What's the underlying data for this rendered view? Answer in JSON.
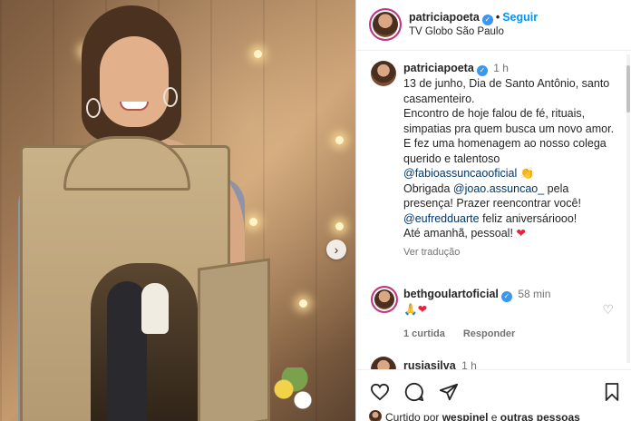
{
  "photo": {
    "next_label": "›"
  },
  "header": {
    "username": "patriciapoeta",
    "separator": "•",
    "follow_label": "Seguir",
    "location": "TV Globo São Paulo"
  },
  "caption": {
    "username": "patriciapoeta",
    "time": "1 h",
    "line1": "13 de junho, Dia de Santo Antônio, santo casamenteiro.",
    "line2": "Encontro de hoje falou de fé, rituais, simpatias pra quem busca um novo amor.",
    "line3": "E fez uma homenagem ao nosso colega querido e talentoso",
    "mention1": "@fabioassuncaooficial",
    "emoji1": "👏",
    "line4_pre": "Obrigada",
    "mention2": "@joao.assuncao_",
    "line4_post": "pela presença! Prazer reencontrar você!",
    "mention3": "@eufredduarte",
    "line5_post": "feliz aniversáriooo!",
    "line6": "Até amanhã, pessoal!",
    "emoji2": "❤",
    "translate": "Ver tradução"
  },
  "comment": {
    "username": "bethgoulartoficial",
    "time": "58 min",
    "text": "🙏❤",
    "likes": "1 curtida",
    "reply": "Responder"
  },
  "comment_next": {
    "username": "rusiasilva",
    "time": "1 h"
  },
  "actions": {
    "liked_prefix": "Curtido por",
    "liked_user": "wespinel",
    "liked_suffix": "e",
    "liked_others": "outras pessoas"
  },
  "colors": {
    "link": "#0095f6",
    "mention": "#00376b",
    "verified": "#3897f0",
    "muted": "#737373",
    "heart": "#ed1f3a"
  }
}
